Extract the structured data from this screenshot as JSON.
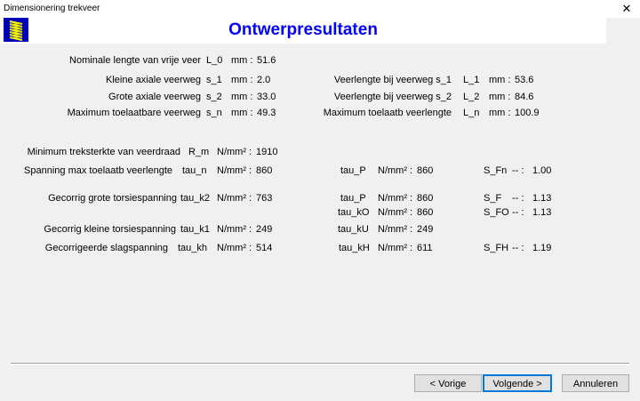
{
  "window": {
    "title": "Dimensionering trekveer",
    "close_glyph": "✕"
  },
  "heading": "Ontwerpresultaten",
  "colors": {
    "heading": "#0000ff",
    "logo_bg": "#0000b8",
    "logo_coil": "#ffff00",
    "default_button_border": "#0078d7"
  },
  "left": [
    {
      "label": "Nominale lengte van vrije veer",
      "sym": "L_0",
      "unit": "mm :",
      "value": "51.6"
    },
    {
      "label": "Kleine axiale veerweg",
      "sym": "s_1",
      "unit": "mm :",
      "value": "2.0"
    },
    {
      "label": "Grote axiale veerweg",
      "sym": "s_2",
      "unit": "mm :",
      "value": "33.0"
    },
    {
      "label": "Maximum toelaatbare veerweg",
      "sym": "s_n",
      "unit": "mm :",
      "value": "49.3"
    }
  ],
  "right": [
    {
      "label": "Veerlengte bij veerweg s_1",
      "sym": "L_1",
      "unit": "mm :",
      "value": "53.6"
    },
    {
      "label": "Veerlengte bij veerweg s_2",
      "sym": "L_2",
      "unit": "mm :",
      "value": "84.6"
    },
    {
      "label": "Maximum toelaatb veerlengte",
      "sym": "L_n",
      "unit": "mm :",
      "value": "100.9"
    }
  ],
  "stress": [
    {
      "label": "Minimum treksterkte van veerdraad",
      "sym": "R_m",
      "unit": "N/mm² :",
      "value": "1910"
    },
    {
      "label": "Spanning max toelaatb veerlengte",
      "sym": "tau_n",
      "unit": "N/mm² :",
      "value": "860"
    },
    {
      "label": "Gecorrig grote torsiespanning",
      "sym": "tau_k2",
      "unit": "N/mm² :",
      "value": "763"
    },
    {
      "label": "Gecorrig kleine torsiespanning",
      "sym": "tau_k1",
      "unit": "N/mm² :",
      "value": "249"
    },
    {
      "label": "Gecorrigeerde slagspanning",
      "sym": "tau_kh",
      "unit": "N/mm² :",
      "value": "514"
    }
  ],
  "perm": [
    {
      "sym": "tau_P",
      "unit": "N/mm² :",
      "value": "860"
    },
    {
      "sym": "tau_P",
      "unit": "N/mm² :",
      "value": "860"
    },
    {
      "sym": "tau_kO",
      "unit": "N/mm² :",
      "value": "860"
    },
    {
      "sym": "tau_kU",
      "unit": "N/mm² :",
      "value": "249"
    },
    {
      "sym": "tau_kH",
      "unit": "N/mm² :",
      "value": "611"
    }
  ],
  "safety": [
    {
      "sym": "S_Fn",
      "unit": "-- :",
      "value": "1.00"
    },
    {
      "sym": "S_F",
      "unit": "-- :",
      "value": "1.13"
    },
    {
      "sym": "S_FO",
      "unit": "-- :",
      "value": "1.13"
    },
    {
      "sym": "S_FH",
      "unit": "-- :",
      "value": "1.19"
    }
  ],
  "buttons": {
    "prev": "< Vorige",
    "next": "Volgende >",
    "cancel": "Annuleren"
  }
}
